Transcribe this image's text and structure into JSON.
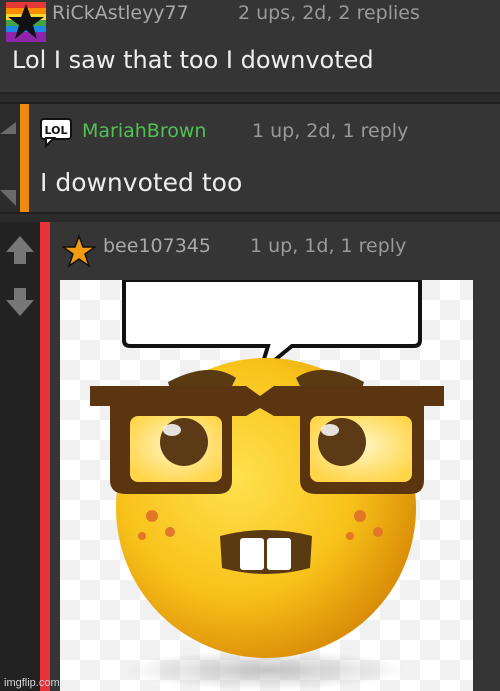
{
  "comments": [
    {
      "username": "RiCkAstleyy77",
      "meta": "2 ups, 2d, 2 replies",
      "text": "Lol I saw that too I downvoted",
      "avatar_icon": "rainbow-star-icon"
    },
    {
      "username": "MariahBrown",
      "meta": "1 up, 2d, 1 reply",
      "text": "I downvoted too",
      "avatar_icon": "lol-speech-bubble-icon",
      "thread_color": "#ef8a10",
      "username_color": "#52c153"
    },
    {
      "username": "bee107345",
      "meta": "1 up, 1d, 1 reply",
      "avatar_icon": "orange-star-icon",
      "thread_color": "#e8333a",
      "image_icon": "nerd-emoji-meme-image"
    }
  ],
  "watermark": "imgflip.com",
  "avatar_lol": "LOL"
}
